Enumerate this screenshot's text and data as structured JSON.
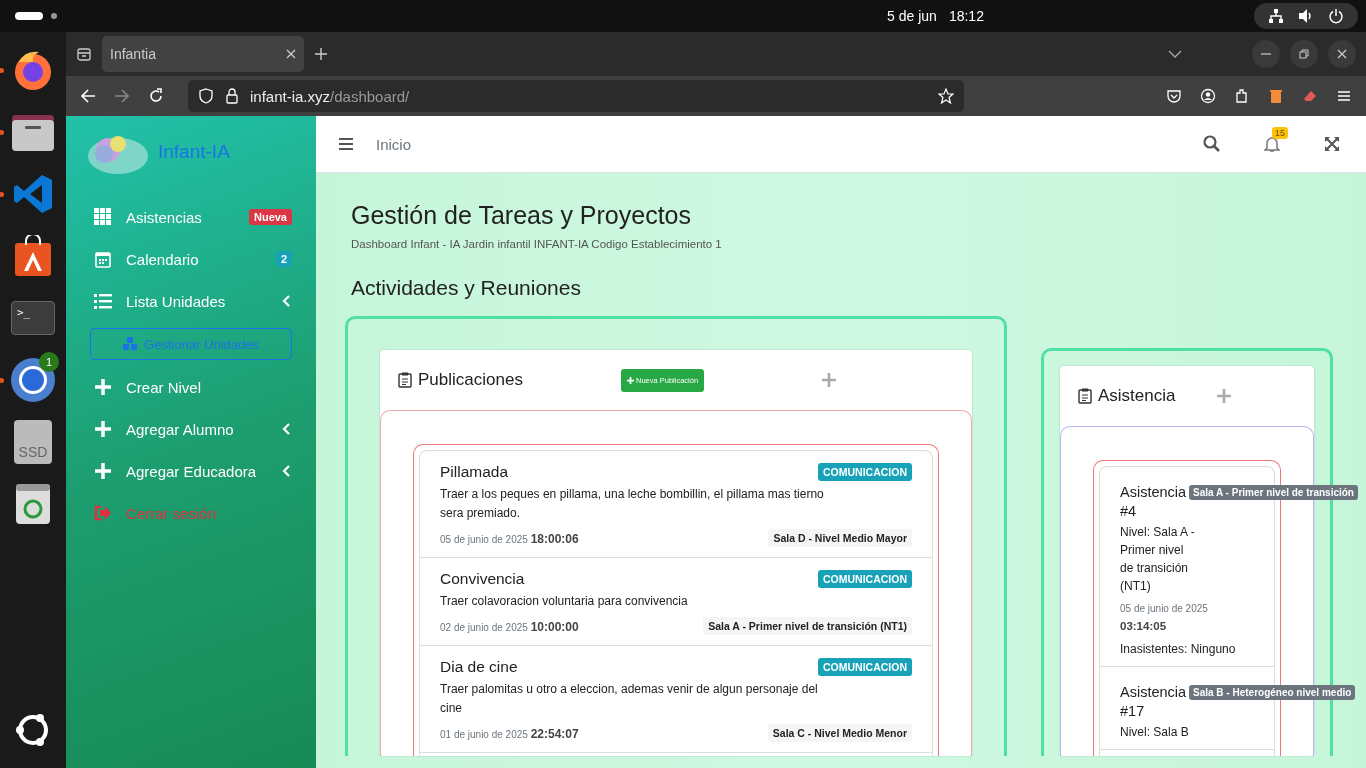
{
  "topbar": {
    "date": "5 de jun",
    "time": "18:12"
  },
  "dock": [
    {
      "kind": "firefox",
      "running": true
    },
    {
      "kind": "files",
      "running": true
    },
    {
      "kind": "vscode",
      "running": true
    },
    {
      "kind": "store",
      "running": false
    },
    {
      "kind": "terminal",
      "running": false,
      "prompt": ">_"
    },
    {
      "kind": "chrome",
      "running": true,
      "badge": "1"
    },
    {
      "kind": "drive",
      "running": false,
      "label": "SSD"
    },
    {
      "kind": "trash",
      "running": false
    },
    {
      "kind": "ubuntu",
      "running": false
    }
  ],
  "browser": {
    "tab": {
      "title": "Infantia"
    },
    "url_host": "infant-ia.xyz",
    "url_path": "/dashboard/"
  },
  "sidebar": {
    "brand": "Infant-IA",
    "items": [
      {
        "kind": "link",
        "label": "Asistencias",
        "badge": {
          "text": "Nueva",
          "color": "#dc3545"
        },
        "expandable": false
      },
      {
        "kind": "link",
        "label": "Calendario",
        "badge": {
          "text": "2",
          "color": "#17a2b8"
        },
        "expandable": false
      },
      {
        "kind": "link",
        "label": "Lista Unidades",
        "expandable": true
      },
      {
        "kind": "button",
        "label": "Gestionar Unidades"
      },
      {
        "kind": "link",
        "label": "Crear Nivel",
        "expandable": false
      },
      {
        "kind": "link",
        "label": "Agregar Alumno",
        "expandable": true
      },
      {
        "kind": "link",
        "label": "Agregar Educadora",
        "expandable": true
      },
      {
        "kind": "logout",
        "label": "Cerrar sesión"
      }
    ]
  },
  "header": {
    "breadcrumb": "Inicio",
    "notifications": "15"
  },
  "page": {
    "title": "Gestión de Tareas y Proyectos",
    "subtitle": "Dashboard Infant - IA Jardin infantil INFANT-IA Codigo Establecimiento 1",
    "section": "Actividades y Reuniones"
  },
  "publicaciones": {
    "title": "Publicaciones",
    "new_button": "Nueva Publicación",
    "items": [
      {
        "title": "Pillamada",
        "description": "Traer a los peques en pillama, una leche bombillin, el pillama mas tierno sera premiado.",
        "tag": "COMUNICACION",
        "date": "05 de junio de 2025",
        "time": "18:00:06",
        "room": "Sala D - Nivel Medio Mayor"
      },
      {
        "title": "Convivencia",
        "description": "Traer colavoracion voluntaria para convivencia",
        "tag": "COMUNICACION",
        "date": "02 de junio de 2025",
        "time": "10:00:00",
        "room": "Sala A - Primer nivel de transición (NT1)"
      },
      {
        "title": "Dia de cine",
        "description": "Traer palomitas u otro a eleccion, ademas venir de algun personaje del cine",
        "tag": "COMUNICACION",
        "date": "01 de junio de 2025",
        "time": "22:54:07",
        "room": "Sala C - Nivel Medio Menor"
      }
    ]
  },
  "asistencia": {
    "title": "Asistencia",
    "items": [
      {
        "title": "Asistencia #4",
        "tooltip": "Sala A - Primer nivel de transición",
        "group": "Nivel: Sala A - Primer nivel de transición (NT1)",
        "date": "05 de junio de 2025",
        "time": "03:14:05",
        "absent": "Inasistentes: Ninguno"
      },
      {
        "title": "Asistencia #17",
        "tooltip": "Sala B - Heterogéneo nivel medio",
        "group": "Nivel: Sala B"
      }
    ]
  }
}
